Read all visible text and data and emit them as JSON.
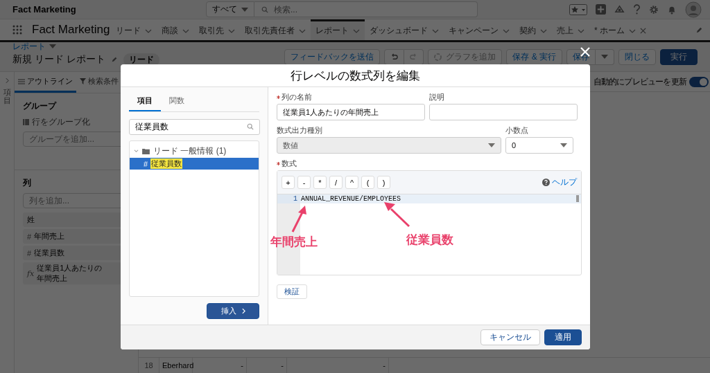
{
  "header": {
    "app_title": "Fact Marketing",
    "search_scope": "すべて",
    "search_placeholder": "検索..."
  },
  "nav": {
    "app_name": "Fact Marketing",
    "tabs": [
      {
        "label": "リード",
        "selected": false,
        "closable": false
      },
      {
        "label": "商談",
        "selected": false,
        "closable": false
      },
      {
        "label": "取引先",
        "selected": false,
        "closable": false
      },
      {
        "label": "取引先責任者",
        "selected": false,
        "closable": false
      },
      {
        "label": "レポート",
        "selected": true,
        "closable": false
      },
      {
        "label": "ダッシュボード",
        "selected": false,
        "closable": false
      },
      {
        "label": "キャンペーン",
        "selected": false,
        "closable": false
      },
      {
        "label": "契約",
        "selected": false,
        "closable": false
      },
      {
        "label": "売上",
        "selected": false,
        "closable": false
      },
      {
        "label": "* ホーム",
        "selected": false,
        "closable": true
      }
    ]
  },
  "page_header": {
    "breadcrumb": "レポート",
    "title": "新規 リード レポート",
    "badge": "リード",
    "buttons": [
      {
        "label": "フィードバックを送信",
        "kind": "neutral",
        "disabled": false
      },
      {
        "kind": "undo-redo",
        "disabled": false
      },
      {
        "label": "グラフを追加",
        "kind": "neutral",
        "disabled": true
      },
      {
        "label": "保存 & 実行",
        "kind": "neutral",
        "disabled": false
      },
      {
        "label": "保存",
        "kind": "split",
        "disabled": false
      },
      {
        "label": "閉じる",
        "kind": "neutral",
        "disabled": false
      },
      {
        "label": "実行",
        "kind": "brand",
        "disabled": false
      }
    ]
  },
  "side_rail": {
    "label": "項目"
  },
  "outline": {
    "tabs": [
      {
        "label": "アウトライン",
        "selected": true
      },
      {
        "label": "検索条件",
        "selected": false
      }
    ],
    "groups": {
      "heading": "グループ",
      "sub_label": "行をグループ化",
      "placeholder": "グループを追加..."
    },
    "columns": {
      "heading": "列",
      "placeholder": "列を追加...",
      "items": [
        {
          "label": "姓"
        },
        {
          "icon": "#",
          "label": "年間売上"
        },
        {
          "icon": "#",
          "label": "従業員数"
        },
        {
          "icon": "fx",
          "label": "従業員1人あたりの年間売上"
        }
      ]
    }
  },
  "preview": {
    "toggle_label": "自動的にプレビューを更新",
    "on": true
  },
  "table": {
    "rows": [
      {
        "number": "18",
        "cells": [
          "Eberhard",
          "-",
          "-",
          "-"
        ]
      }
    ]
  },
  "modal": {
    "title": "行レベルの数式列を編集",
    "left": {
      "tabs": [
        {
          "label": "項目",
          "selected": true
        },
        {
          "label": "関数",
          "selected": false
        }
      ],
      "search_value": "従業員数",
      "tree": [
        {
          "label": "リード 一般情報 (1)",
          "expanded": true,
          "children": [
            {
              "icon": "#",
              "label": "従業員数",
              "selected": true,
              "highlighted": true
            }
          ]
        }
      ],
      "insert_button": "挿入"
    },
    "fields": [
      {
        "label": "列の名前",
        "required": true,
        "kind": "input",
        "value": "従業員1人あたりの年間売上"
      },
      {
        "label": "説明",
        "required": false,
        "kind": "input"
      },
      {
        "label": "数式出力種別",
        "required": false,
        "kind": "select",
        "value": "数値",
        "disabled": true
      },
      {
        "label": "小数点",
        "required": false,
        "kind": "select",
        "value": "0",
        "disabled": false
      }
    ],
    "formula": {
      "label": "数式",
      "required": true,
      "operators": [
        "+",
        "-",
        "*",
        "/",
        "^",
        "(",
        ")"
      ],
      "help": "ヘルプ",
      "lines": [
        {
          "number": "1",
          "code": "ANNUAL_REVENUE/EMPLOYEES"
        }
      ]
    },
    "validate_button": "検証",
    "cancel_button": "キャンセル",
    "apply_button": "適用"
  },
  "annotations": [
    {
      "text": "年間売上"
    },
    {
      "text": "従業員数"
    }
  ]
}
